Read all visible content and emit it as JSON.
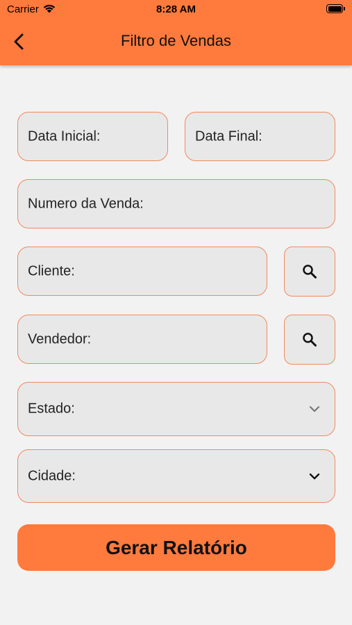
{
  "status_bar": {
    "carrier": "Carrier",
    "time": "8:28 AM"
  },
  "header": {
    "title": "Filtro de Vendas"
  },
  "form": {
    "data_inicial": "Data Inicial:",
    "data_final": "Data Final:",
    "numero_venda": "Numero da Venda:",
    "cliente": "Cliente:",
    "vendedor": "Vendedor:",
    "estado": "Estado:",
    "cidade": "Cidade:"
  },
  "actions": {
    "gerar_relatorio": "Gerar Relatório"
  },
  "colors": {
    "accent": "#ff7a3d",
    "field_border": "#f08a5d",
    "field_bg": "#e8e8e8",
    "background": "#f2f2f2"
  },
  "icons": [
    "back-icon",
    "search-icon",
    "chevron-down-icon",
    "wifi-icon",
    "battery-icon"
  ]
}
